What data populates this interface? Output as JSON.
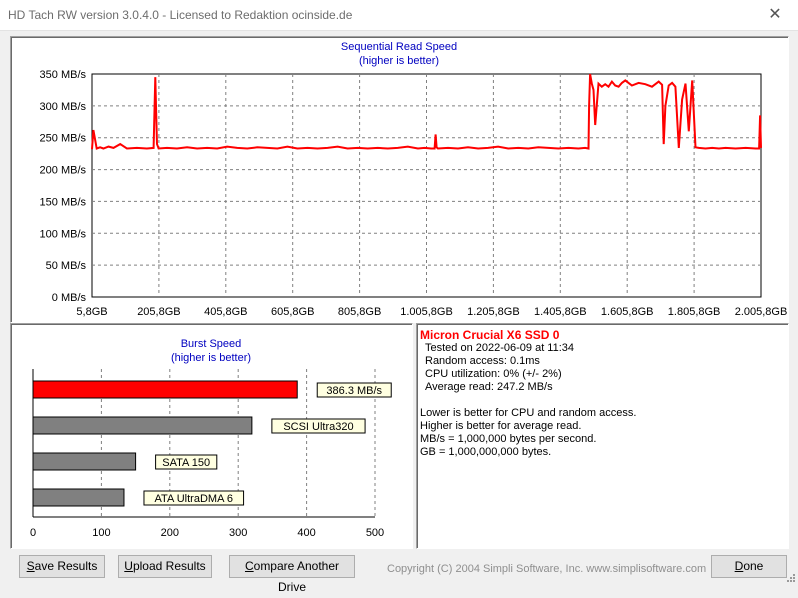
{
  "window": {
    "title": "HD Tach RW version 3.0.4.0 - Licensed to Redaktion ocinside.de"
  },
  "sequential": {
    "title": "Sequential Read Speed",
    "subtitle": "(higher is better)"
  },
  "burst": {
    "title": "Burst Speed",
    "subtitle": "(higher is better)"
  },
  "info": {
    "drive_name": "Micron Crucial X6 SSD 0",
    "tested_on": "Tested on 2022-06-09 at 11:34",
    "random_access": "Random access: 0.1ms",
    "cpu_utilization": "CPU utilization: 0% (+/- 2%)",
    "average_read": "Average read: 247.2 MB/s",
    "note1": "Lower is better for CPU and random access.",
    "note2": "Higher is better for average read.",
    "note3": "MB/s = 1,000,000 bytes per second.",
    "note4": "GB = 1,000,000,000 bytes."
  },
  "buttons": {
    "save": "Save Results",
    "upload": "Upload Results",
    "compare": "Compare Another Drive",
    "done": "Done"
  },
  "footer": {
    "copyright": "Copyright (C) 2004 Simpli Software, Inc. www.simplisoftware.com"
  },
  "colors": {
    "series": "#ff0000",
    "drive_bar": "#ff0000",
    "ref_bar": "#808080",
    "label_bg": "#ffffe1",
    "title_blue": "#0000c0"
  },
  "chart_data": [
    {
      "type": "line",
      "title": "Sequential Read Speed",
      "subtitle": "(higher is better)",
      "xlabel": "",
      "ylabel": "",
      "x_tick_labels": [
        "5,8GB",
        "205,8GB",
        "405,8GB",
        "605,8GB",
        "805,8GB",
        "1.005,8GB",
        "1.205,8GB",
        "1.405,8GB",
        "1.605,8GB",
        "1.805,8GB",
        "2.005,8GB"
      ],
      "y_tick_labels": [
        "0 MB/s",
        "50 MB/s",
        "100 MB/s",
        "150 MB/s",
        "200 MB/s",
        "250 MB/s",
        "300 MB/s",
        "350 MB/s"
      ],
      "xlim": [
        5.8,
        2005.8
      ],
      "ylim": [
        0,
        350
      ],
      "grid": true,
      "series": [
        {
          "x": [
            5.8,
            10,
            20,
            30,
            40,
            55,
            70,
            90,
            110,
            140,
            170,
            190,
            195,
            197,
            200,
            205,
            230,
            260,
            290,
            320,
            350,
            380,
            410,
            440,
            470,
            500,
            530,
            560,
            590,
            620,
            650,
            680,
            710,
            740,
            770,
            800,
            830,
            860,
            890,
            920,
            950,
            980,
            1000,
            1020,
            1030,
            1033,
            1036,
            1040,
            1070,
            1100,
            1130,
            1160,
            1190,
            1220,
            1250,
            1280,
            1310,
            1340,
            1370,
            1400,
            1430,
            1460,
            1480,
            1490,
            1492,
            1495,
            1500,
            1505,
            1510,
            1520,
            1530,
            1540,
            1550,
            1560,
            1570,
            1580,
            1590,
            1600,
            1620,
            1640,
            1660,
            1680,
            1700,
            1710,
            1715,
            1720,
            1730,
            1740,
            1750,
            1760,
            1770,
            1780,
            1790,
            1800,
            1810,
            1820,
            1840,
            1860,
            1880,
            1900,
            1930,
            1960,
            1990,
            2000,
            2003,
            2005.8
          ],
          "values": [
            232,
            262,
            233,
            235,
            233,
            236,
            234,
            240,
            233,
            234,
            233,
            234,
            345,
            300,
            240,
            233,
            234,
            233,
            235,
            233,
            234,
            233,
            236,
            234,
            233,
            235,
            234,
            233,
            236,
            233,
            234,
            233,
            234,
            236,
            233,
            234,
            233,
            234,
            233,
            234,
            236,
            233,
            234,
            233,
            233,
            255,
            235,
            233,
            234,
            233,
            235,
            233,
            234,
            236,
            233,
            234,
            233,
            235,
            234,
            233,
            234,
            233,
            234,
            233,
            300,
            350,
            335,
            325,
            270,
            335,
            330,
            334,
            330,
            338,
            332,
            330,
            336,
            340,
            332,
            336,
            334,
            330,
            338,
            333,
            240,
            300,
            332,
            336,
            330,
            234,
            310,
            335,
            260,
            340,
            235,
            234,
            233,
            234,
            233,
            234,
            233,
            234,
            233,
            233,
            285,
            234
          ]
        }
      ]
    },
    {
      "type": "bar",
      "orientation": "horizontal",
      "title": "Burst Speed",
      "subtitle": "(higher is better)",
      "xlim": [
        0,
        500
      ],
      "x_tick_labels": [
        "0",
        "100",
        "200",
        "300",
        "400",
        "500"
      ],
      "grid": true,
      "categories": [
        "386.3 MB/s",
        "SCSI Ultra320",
        "SATA 150",
        "ATA UltraDMA 6"
      ],
      "values": [
        386.3,
        320,
        150,
        133
      ]
    }
  ]
}
